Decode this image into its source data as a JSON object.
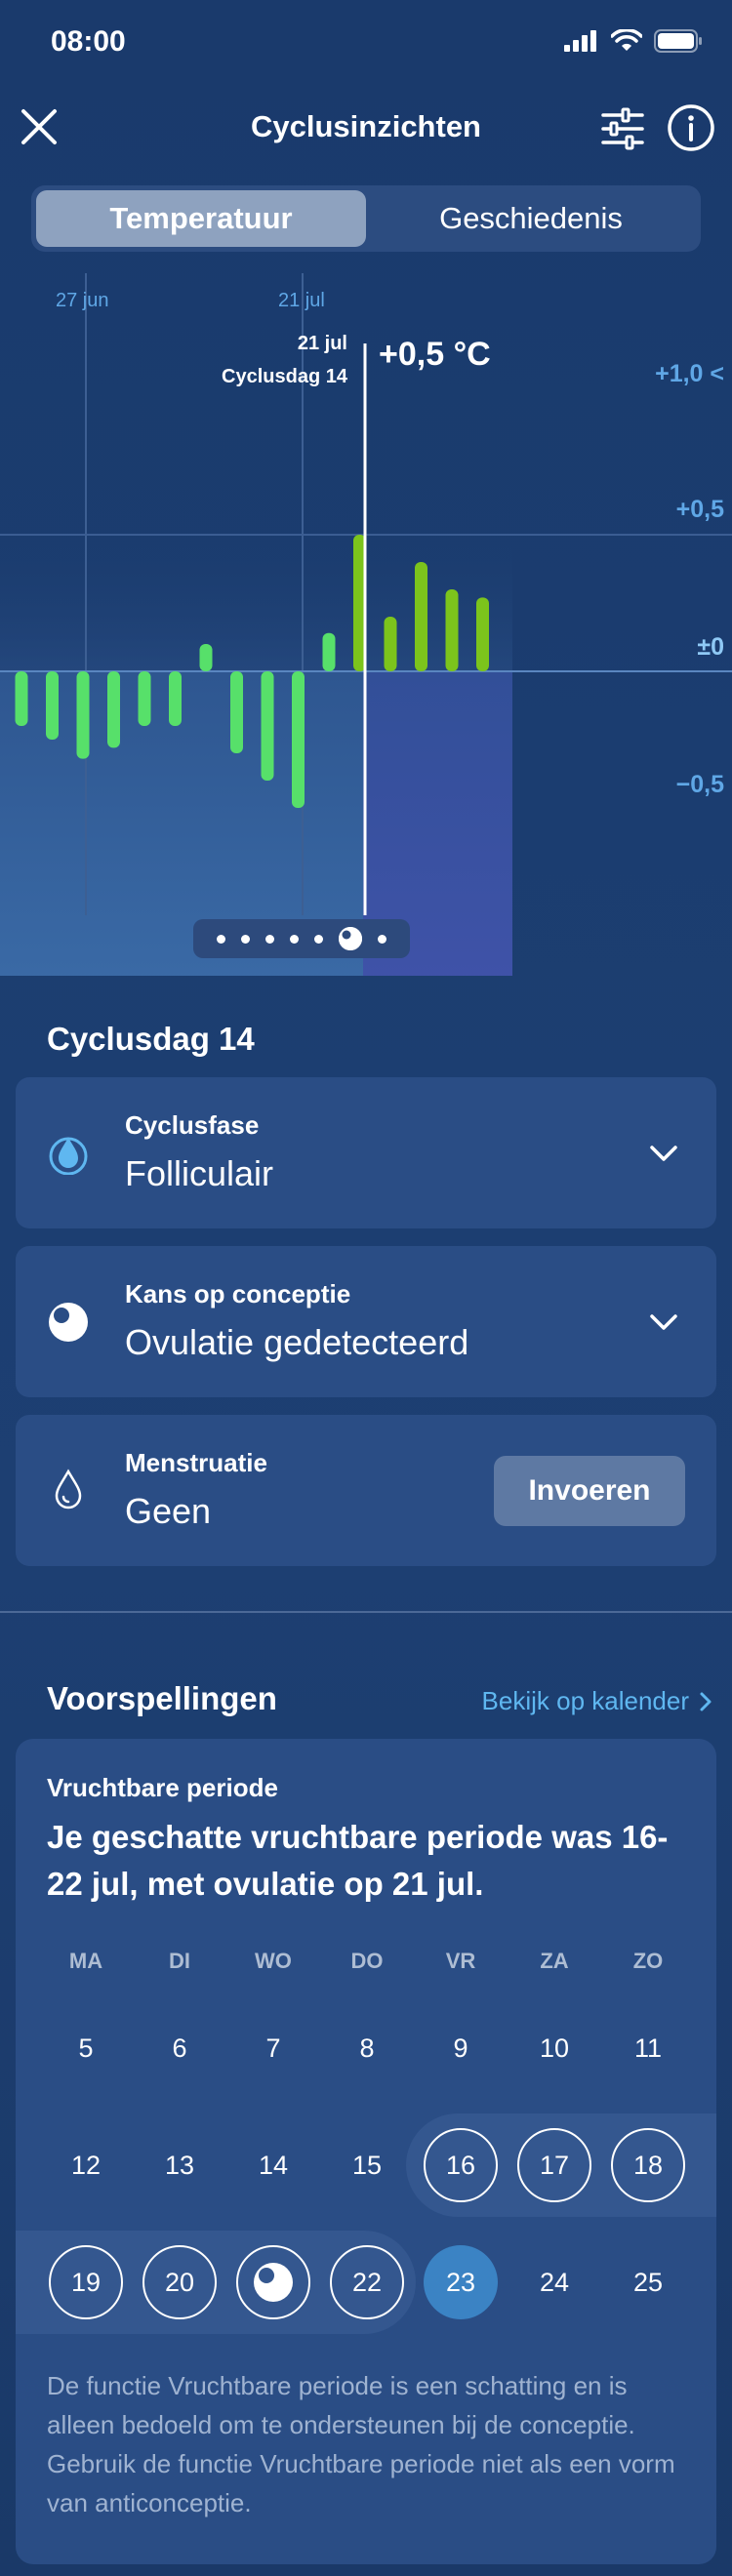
{
  "status": {
    "time": "08:00"
  },
  "header": {
    "title": "Cyclusinzichten"
  },
  "tabs": [
    {
      "label": "Temperatuur",
      "active": true
    },
    {
      "label": "Geschiedenis",
      "active": false
    }
  ],
  "chart_data": {
    "type": "bar",
    "date_labels": [
      "27 jun",
      "21 jul"
    ],
    "cursor": {
      "date": "21 jul",
      "day": "Cyclusdag 14",
      "value": "+0,5 °C"
    },
    "y_ticks": [
      "+1,0 <",
      "+0,5",
      "±0",
      "−0,5"
    ],
    "ylim": [
      -0.9,
      1.1
    ],
    "values": [
      -0.2,
      -0.25,
      -0.32,
      -0.28,
      -0.2,
      -0.2,
      0.1,
      -0.3,
      -0.4,
      -0.5,
      0.14,
      0.5,
      0.2,
      0.4,
      0.3,
      0.27
    ],
    "pager_dots": 7,
    "pager_active_index": 5
  },
  "cycle_day": {
    "title": "Cyclusdag 14"
  },
  "cards": {
    "phase": {
      "label": "Cyclusfase",
      "value": "Folliculair"
    },
    "conception": {
      "label": "Kans op conceptie",
      "value": "Ovulatie gedetecteerd"
    },
    "menstruation": {
      "label": "Menstruatie",
      "value": "Geen",
      "button": "Invoeren"
    }
  },
  "predictions": {
    "title": "Voorspellingen",
    "calendar_link": "Bekijk op kalender",
    "card_label": "Vruchtbare periode",
    "text": "Je geschatte vruchtbare periode was 16-22 jul, met ovulatie op 21 jul.",
    "weekdays": [
      "MA",
      "DI",
      "WO",
      "DO",
      "VR",
      "ZA",
      "ZO"
    ],
    "weeks": [
      [
        "5",
        "6",
        "7",
        "8",
        "9",
        "10",
        "11"
      ],
      [
        "12",
        "13",
        "14",
        "15",
        "16",
        "17",
        "18"
      ],
      [
        "19",
        "20",
        "",
        "22",
        "23",
        "24",
        "25"
      ]
    ],
    "disclaimer": "De functie Vruchtbare periode is een schatting en is alleen bedoeld om te ondersteunen bij de conceptie. Gebruik de functie Vruchtbare periode niet als een vorm van anticonceptie."
  },
  "colors": {
    "accent": "#5fb7f0",
    "bar_green_light": "#57e06a",
    "bar_green_dark": "#7cc41c",
    "today": "#3b83c4"
  }
}
